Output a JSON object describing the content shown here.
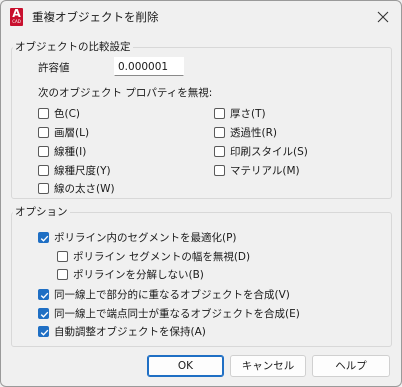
{
  "window": {
    "title": "重複オブジェクトを削除",
    "app_icon_letter": "A",
    "app_icon_sub": "CAD"
  },
  "comparison": {
    "group_title": "オブジェクトの比較設定",
    "tolerance_label": "許容値",
    "tolerance_value": "0.000001",
    "ignore_heading": "次のオブジェクト プロパティを無視:",
    "properties": [
      {
        "label": "色(C)",
        "checked": false
      },
      {
        "label": "画層(L)",
        "checked": false
      },
      {
        "label": "線種(I)",
        "checked": false
      },
      {
        "label": "線種尺度(Y)",
        "checked": false
      },
      {
        "label": "線の太さ(W)",
        "checked": false
      },
      {
        "label": "厚さ(T)",
        "checked": false
      },
      {
        "label": "透過性(R)",
        "checked": false
      },
      {
        "label": "印刷スタイル(S)",
        "checked": false
      },
      {
        "label": "マテリアル(M)",
        "checked": false
      }
    ]
  },
  "options": {
    "group_title": "オプション",
    "items": [
      {
        "label": "ポリライン内のセグメントを最適化(P)",
        "checked": true
      },
      {
        "label": "ポリライン セグメントの幅を無視(D)",
        "checked": false
      },
      {
        "label": "ポリラインを分解しない(B)",
        "checked": false
      },
      {
        "label": "同一線上で部分的に重なるオブジェクトを合成(V)",
        "checked": true
      },
      {
        "label": "同一線上で端点同士が重なるオブジェクトを合成(E)",
        "checked": true
      },
      {
        "label": "自動調整オブジェクトを保持(A)",
        "checked": true
      }
    ]
  },
  "buttons": {
    "ok": "OK",
    "cancel": "キャンセル",
    "help": "ヘルプ"
  },
  "colors": {
    "accent": "#1f6fc4",
    "app_icon": "#c8102e"
  }
}
